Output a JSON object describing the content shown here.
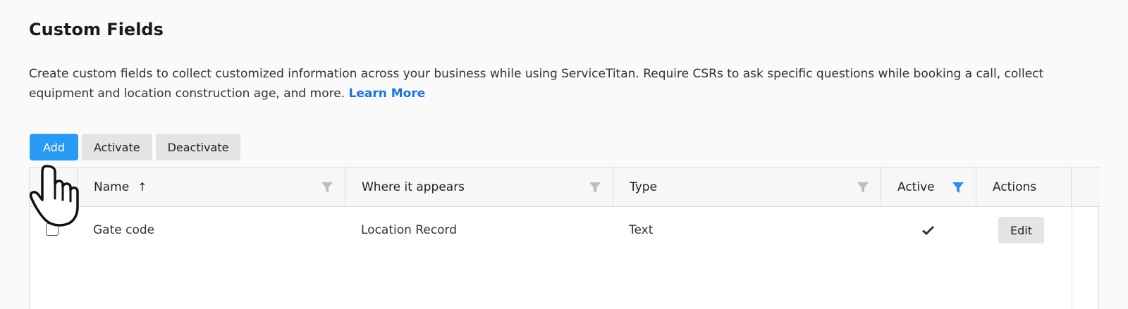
{
  "page": {
    "title": "Custom Fields",
    "description": "Create custom fields to collect customized information across your business while using ServiceTitan. Require CSRs to ask specific questions while booking a call, collect equipment and location construction age, and more.",
    "learn_more": "Learn More"
  },
  "toolbar": {
    "add_label": "Add",
    "activate_label": "Activate",
    "deactivate_label": "Deactivate"
  },
  "table": {
    "columns": [
      {
        "label": "Name",
        "sorted": "ascending",
        "filter_active": false
      },
      {
        "label": "Where it appears",
        "filter_active": false
      },
      {
        "label": "Type",
        "filter_active": false
      },
      {
        "label": "Active",
        "filter_active": true
      },
      {
        "label": "Actions"
      }
    ],
    "rows": [
      {
        "name": "Gate code",
        "where_it_appears": "Location Record",
        "type": "Text",
        "active": true,
        "action_label": "Edit"
      }
    ]
  },
  "icons": {
    "sort": "arrow-up-icon",
    "filter": "funnel-icon",
    "active": "checkmark-icon",
    "cursor": "hand-pointer-icon"
  },
  "colors": {
    "primary": "#2b9af3",
    "link": "#1a73d9",
    "filter_inactive": "#bdbdbd",
    "filter_active": "#2b8fe6"
  }
}
